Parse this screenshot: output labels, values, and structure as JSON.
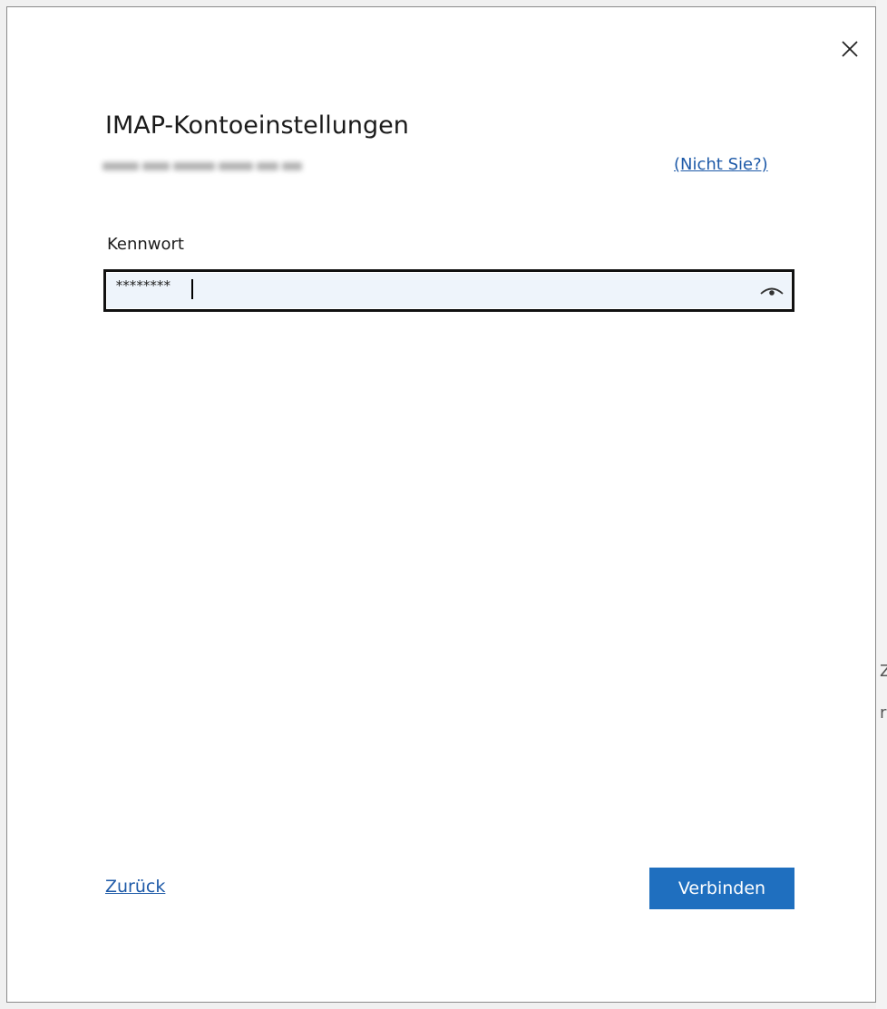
{
  "dialog": {
    "title": "IMAP-Kontoeinstellungen",
    "account_email_blurred": true,
    "not_you_link": "(Nicht Sie?)",
    "close_icon": "close-icon"
  },
  "password": {
    "label": "Kennwort",
    "value": "********",
    "reveal_icon": "eye-icon"
  },
  "footer": {
    "back_link": "Zurück",
    "connect_button": "Verbinden"
  },
  "colors": {
    "accent": "#1f6fbf",
    "link": "#1e5aa8",
    "field_background": "#eef4fb"
  },
  "background_glyphs": [
    "Z",
    "r"
  ]
}
